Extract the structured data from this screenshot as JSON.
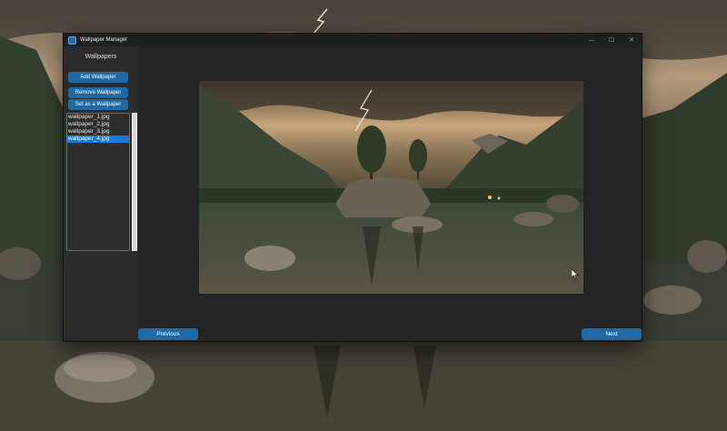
{
  "window": {
    "title": "Wallpaper Manager",
    "controls": {
      "minimize": "—",
      "maximize": "☐",
      "close": "✕"
    }
  },
  "sidebar": {
    "title": "Wallpapers",
    "buttons": {
      "add": "Add Wallpaper",
      "remove": "Remove Wallpaper",
      "set": "Set as a Wallpaper"
    },
    "files": [
      {
        "name": "wallpaper_1.jpg",
        "selected": false
      },
      {
        "name": "wallpaper_2.jpg",
        "selected": false
      },
      {
        "name": "wallpaper_3.jpg",
        "selected": false
      },
      {
        "name": "wallpaper_4.jpg",
        "selected": true
      }
    ]
  },
  "main": {
    "previous_label": "Previous",
    "next_label": "Next"
  },
  "colors": {
    "accent": "#1f6aa5",
    "selection": "#1e78d7",
    "window_bg": "#242424",
    "sidebar_bg": "#2b2b2b"
  },
  "icons": {
    "app": "app-window-icon",
    "cursor": "mouse-pointer-icon"
  }
}
